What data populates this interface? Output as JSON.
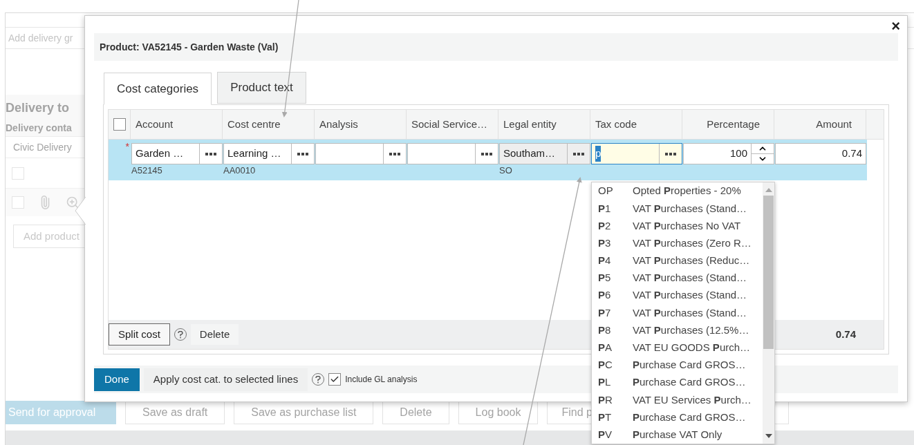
{
  "background_page": {
    "delivery_group_field": {
      "placeholder": "Add delivery gr"
    },
    "section_title": "Delivery to",
    "contact_label": "Delivery conta",
    "contact_field": {
      "value": "Civic Delivery"
    },
    "header_row": {
      "checked": false
    },
    "product_row": {
      "checked": false
    },
    "add_product_button": "Add product",
    "buttons": [
      {
        "label": "Send for approval",
        "kind": "primary"
      },
      {
        "label": "Save as draft",
        "kind": "secondary"
      },
      {
        "label": "Save as purchase list",
        "kind": "secondary"
      },
      {
        "label": "Delete",
        "kind": "secondary"
      },
      {
        "label": "Log book",
        "kind": "secondary"
      },
      {
        "label": "Find p",
        "kind": "wide"
      }
    ]
  },
  "dialog": {
    "close": "×",
    "title": "Product: VA52145 - Garden Waste (Val)",
    "tabs": [
      {
        "label": "Cost categories",
        "selected": true
      },
      {
        "label": "Product text",
        "selected": false
      }
    ],
    "table": {
      "select_all": {
        "checked": false
      },
      "columns": [
        "Account",
        "Cost centre",
        "Analysis",
        "Social Service…",
        "Legal entity",
        "Tax code",
        "Percentage",
        "Amount"
      ],
      "row": {
        "selected": true,
        "required": "*",
        "cells": [
          {
            "kind": "lookup",
            "value": "Garden …",
            "sub": "A52145"
          },
          {
            "kind": "lookup",
            "value": "Learning …",
            "sub": "AA0010"
          },
          {
            "kind": "lookup"
          },
          {
            "kind": "lookup"
          },
          {
            "kind": "lookup",
            "value": "Southam…",
            "sub": "SO",
            "disabled": true
          },
          {
            "kind": "lookup",
            "value": "p",
            "focused": true
          },
          {
            "kind": "spinner",
            "value": "100"
          },
          {
            "kind": "number",
            "value": "0.74"
          }
        ]
      },
      "footer": {
        "split_button": "Split cost",
        "delete_button": "Delete",
        "total": "0.74"
      }
    },
    "bottom_bar": {
      "done_button": "Done",
      "apply_button": "Apply cost cat. to selected lines",
      "include_gl": {
        "label": "Include GL analysis",
        "checked": true
      }
    },
    "tax_dropdown": [
      {
        "code": "OP",
        "label": "Opted **P**roperties - 20%"
      },
      {
        "code": "**P**1",
        "label": "VAT **P**urchases (Stand…"
      },
      {
        "code": "**P**2",
        "label": "VAT **P**urchases No VAT"
      },
      {
        "code": "**P**3",
        "label": "VAT **P**urchases (Zero R…"
      },
      {
        "code": "**P**4",
        "label": "VAT **P**urchases (Reduc…"
      },
      {
        "code": "**P**5",
        "label": "VAT **P**urchases (Stand…"
      },
      {
        "code": "**P**6",
        "label": "VAT **P**urchases (Stand…"
      },
      {
        "code": "**P**7",
        "label": "VAT **P**urchases (Stand…"
      },
      {
        "code": "**P**8",
        "label": "VAT **P**urchases (12.5%…"
      },
      {
        "code": "**P**A",
        "label": "VAT EU GOODS **P**urch…"
      },
      {
        "code": "**P**C",
        "label": "**P**urchase Card GROS…"
      },
      {
        "code": "**P**L",
        "label": "**P**urchase Card GROS…"
      },
      {
        "code": "**P**R",
        "label": "VAT EU Services **P**urch…"
      },
      {
        "code": "**P**T",
        "label": "**P**urchase Card GROS…"
      },
      {
        "code": "**P**V",
        "label": "**P**urchase VAT Only"
      }
    ]
  }
}
